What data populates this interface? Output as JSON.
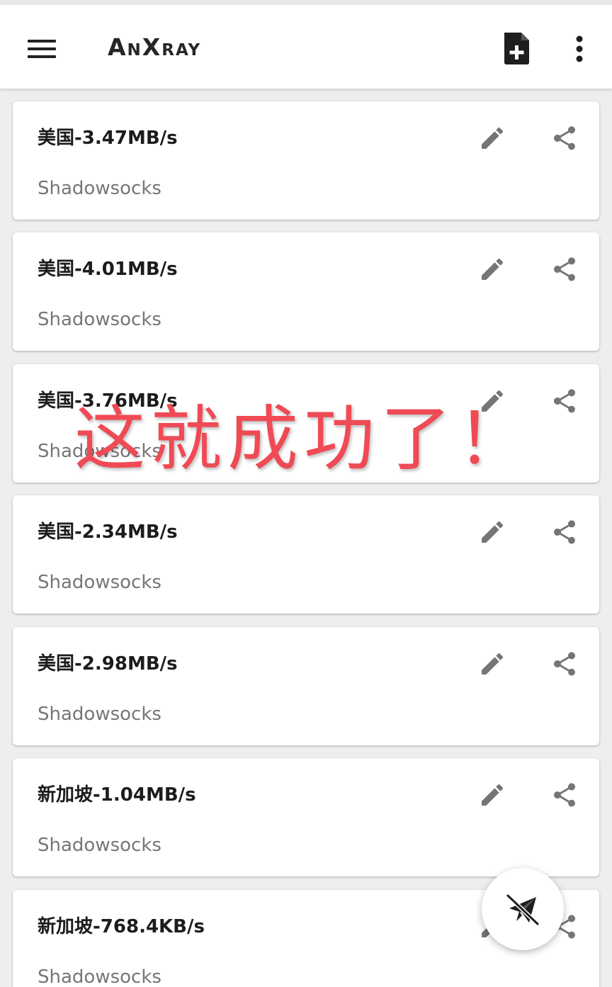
{
  "app": {
    "title": "AnXray"
  },
  "toolbar": {
    "menu_icon": "hamburger-menu-icon",
    "add_icon": "new-profile-file-icon",
    "more_icon": "more-vert-icon"
  },
  "profiles": [
    {
      "name": "美国-3.47MB/s",
      "type": "Shadowsocks"
    },
    {
      "name": "美国-4.01MB/s",
      "type": "Shadowsocks"
    },
    {
      "name": "美国-3.76MB/s",
      "type": "Shadowsocks"
    },
    {
      "name": "美国-2.34MB/s",
      "type": "Shadowsocks"
    },
    {
      "name": "美国-2.98MB/s",
      "type": "Shadowsocks"
    },
    {
      "name": "新加坡-1.04MB/s",
      "type": "Shadowsocks"
    },
    {
      "name": "新加坡-768.4KB/s",
      "type": "Shadowsocks"
    }
  ],
  "card_icons": {
    "edit": "pencil-edit-icon",
    "share": "share-icon"
  },
  "fab": {
    "icon": "plane-disconnected-icon"
  },
  "overlay": {
    "text": "这就成功了！"
  },
  "colors": {
    "background": "#eeeeee",
    "card": "#ffffff",
    "icon_gray": "#757575",
    "overlay_red": "#f04a55"
  }
}
